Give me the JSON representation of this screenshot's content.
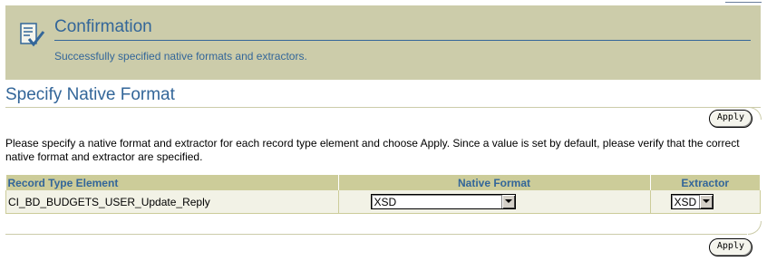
{
  "confirmation": {
    "title": "Confirmation",
    "message": "Successfully specified native formats and extractors.",
    "icon": "confirmation-document-check-icon"
  },
  "section": {
    "title": "Specify Native Format"
  },
  "buttons": {
    "apply_top": "Apply",
    "apply_bottom": "Apply"
  },
  "instructions": "Please specify a native format and extractor for each record type element and choose Apply. Since a value is set by default, please verify that the correct native format and extractor are specified.",
  "table": {
    "columns": [
      "Record Type Element",
      "Native Format",
      "Extractor"
    ],
    "rows": [
      {
        "element": "CI_BD_BUDGETS_USER_Update_Reply",
        "native_format": "XSD",
        "extractor": "XSD"
      }
    ]
  },
  "colors": {
    "header_bg": "#ccccaa",
    "accent_text": "#336699",
    "table_header_bg": "#cccc99"
  }
}
